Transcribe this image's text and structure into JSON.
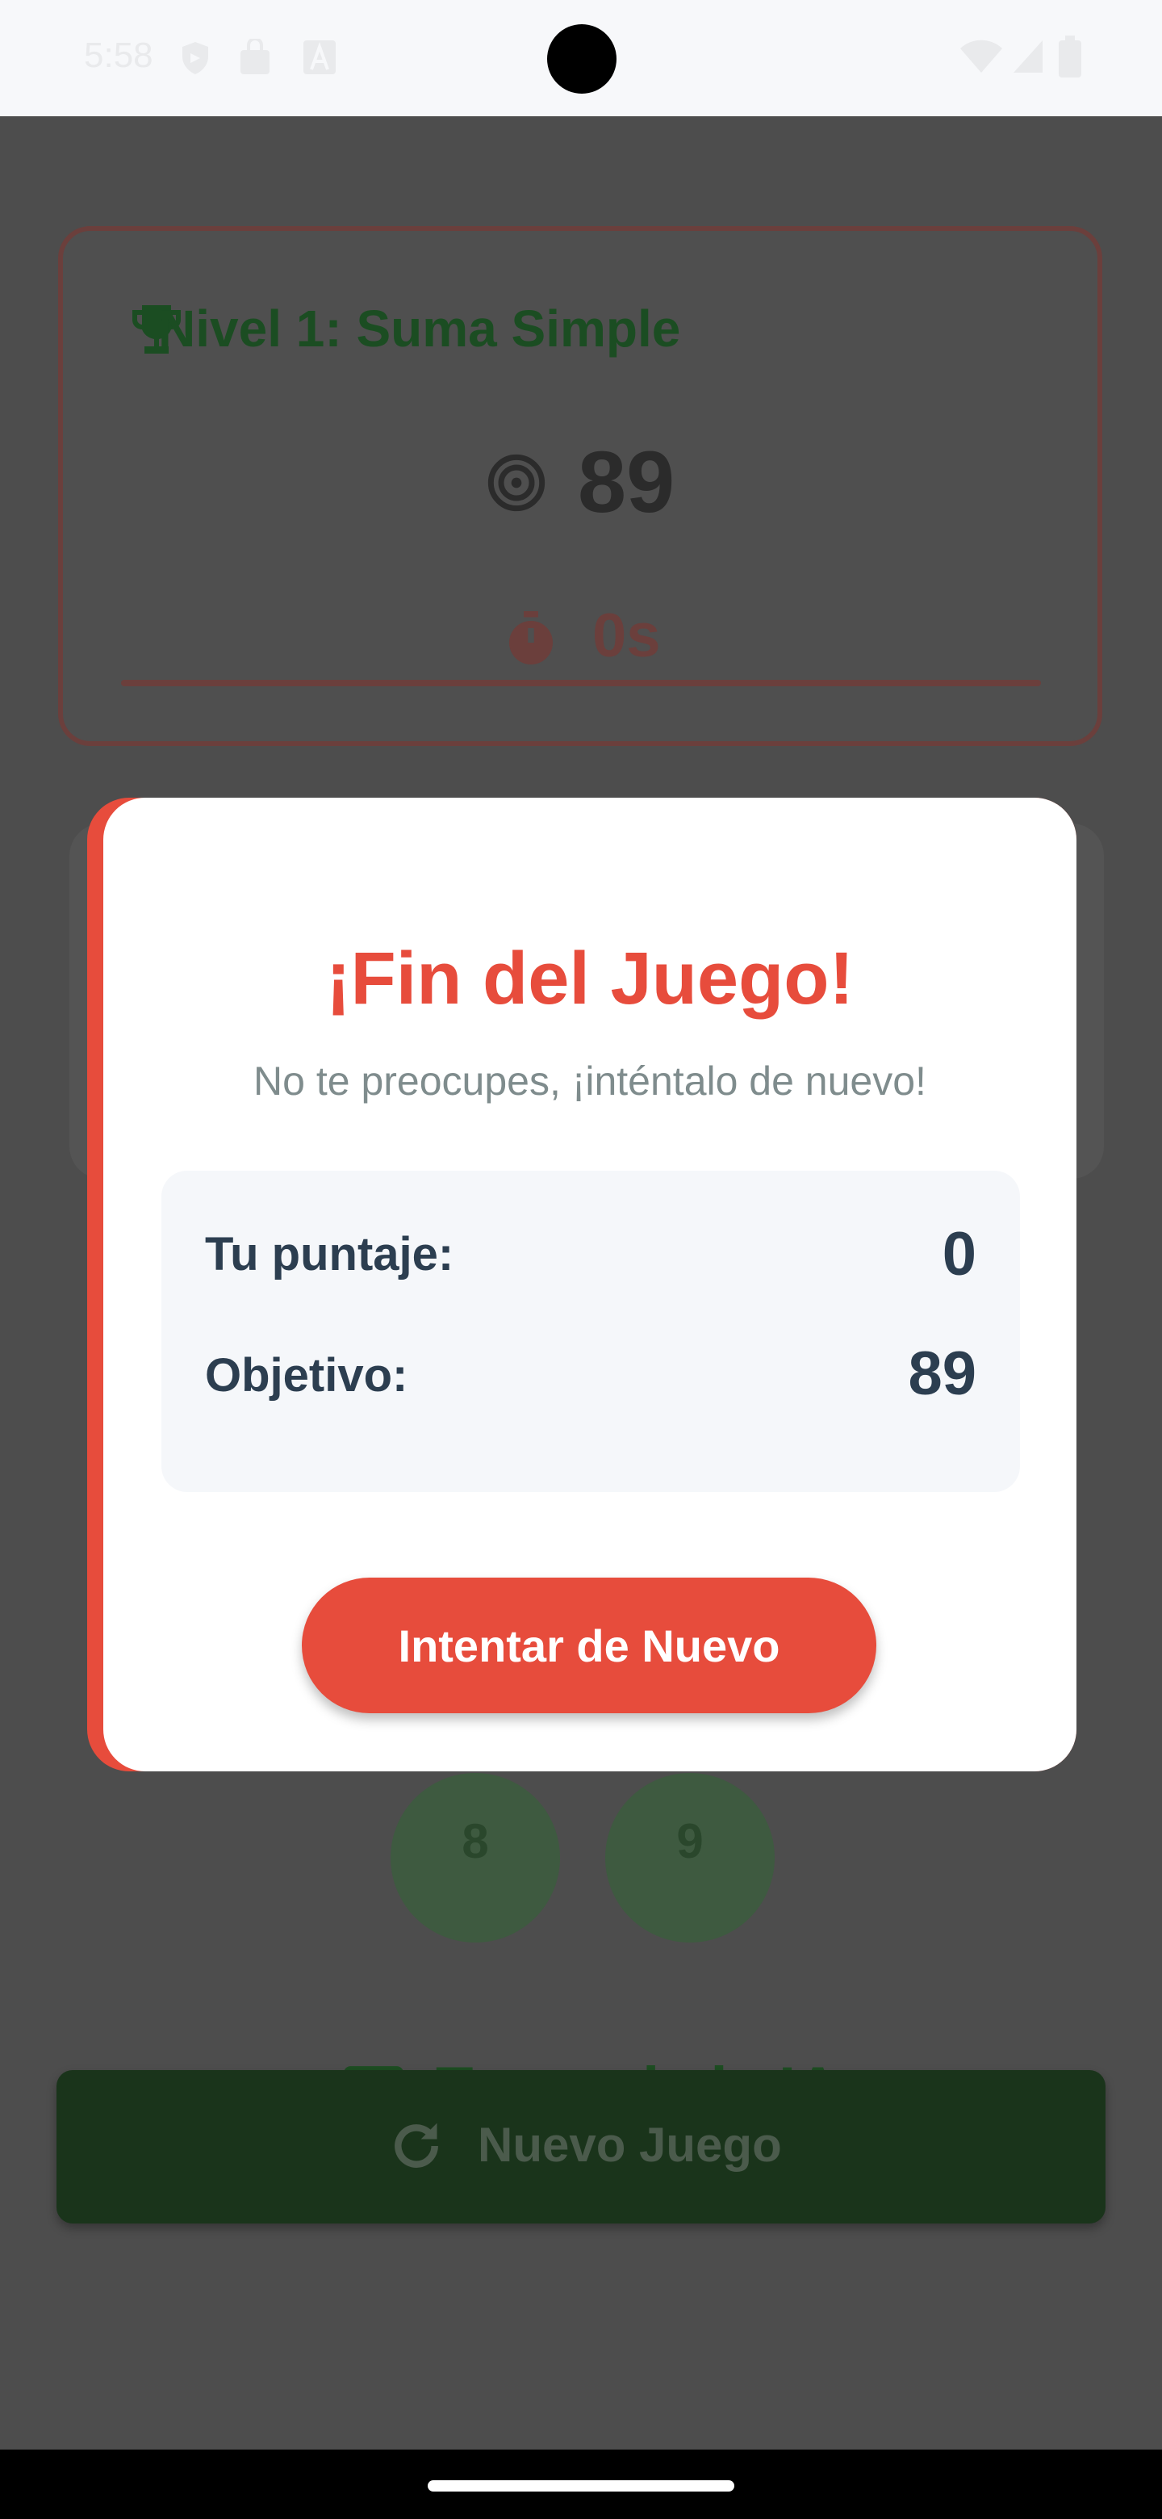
{
  "status_bar": {
    "time": "5:58",
    "icons": [
      "shield-icon",
      "bag-icon",
      "font-icon",
      "wifi-icon",
      "signal-icon",
      "battery-icon"
    ]
  },
  "game": {
    "level_title": "Nivel 1: Suma Simple",
    "target": "89",
    "timer": "0s",
    "numbers": [
      "8",
      "9"
    ],
    "turn_label": "Turno de la IA",
    "new_game_label": "Nuevo Juego"
  },
  "modal": {
    "title": "¡Fin del Juego!",
    "subtitle": "No te preocupes, ¡inténtalo de nuevo!",
    "score_label": "Tu puntaje:",
    "score_value": "0",
    "target_label": "Objetivo:",
    "target_value": "89",
    "retry_label": "Intentar de Nuevo"
  },
  "colors": {
    "accent": "#e74c3c",
    "text_dark": "#2c3e50",
    "text_muted": "#7f8c8d",
    "overlay": "#4d4d4d"
  }
}
